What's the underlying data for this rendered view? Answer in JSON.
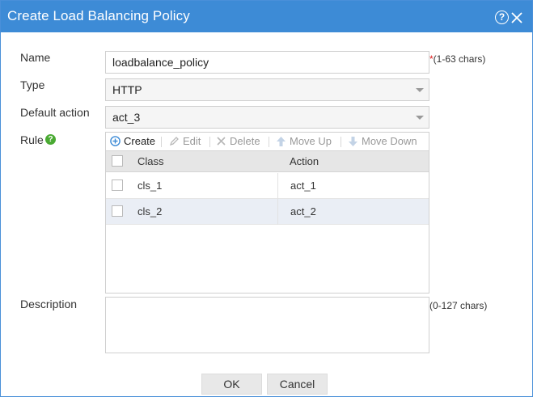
{
  "dialog": {
    "title": "Create Load Balancing Policy",
    "help_glyph": "?",
    "close_icon": "close-icon"
  },
  "form": {
    "name_label": "Name",
    "name_value": "loadbalance_policy",
    "name_required": "*",
    "name_hint": "(1-63 chars)",
    "type_label": "Type",
    "type_value": "HTTP",
    "default_action_label": "Default action",
    "default_action_value": "act_3",
    "rule_label": "Rule",
    "rule_help_glyph": "?",
    "description_label": "Description",
    "description_value": "",
    "description_hint": "(0-127 chars)"
  },
  "rule_toolbar": {
    "create": "Create",
    "edit": "Edit",
    "delete": "Delete",
    "move_up": "Move Up",
    "move_down": "Move Down"
  },
  "rule_table": {
    "columns": [
      "Class",
      "Action"
    ],
    "rows": [
      {
        "class": "cls_1",
        "action": "act_1"
      },
      {
        "class": "cls_2",
        "action": "act_2"
      }
    ]
  },
  "buttons": {
    "ok": "OK",
    "cancel": "Cancel"
  },
  "colors": {
    "titlebar": "#3d8bd6",
    "accent_green": "#4aaa33",
    "required_red": "#e02020"
  }
}
